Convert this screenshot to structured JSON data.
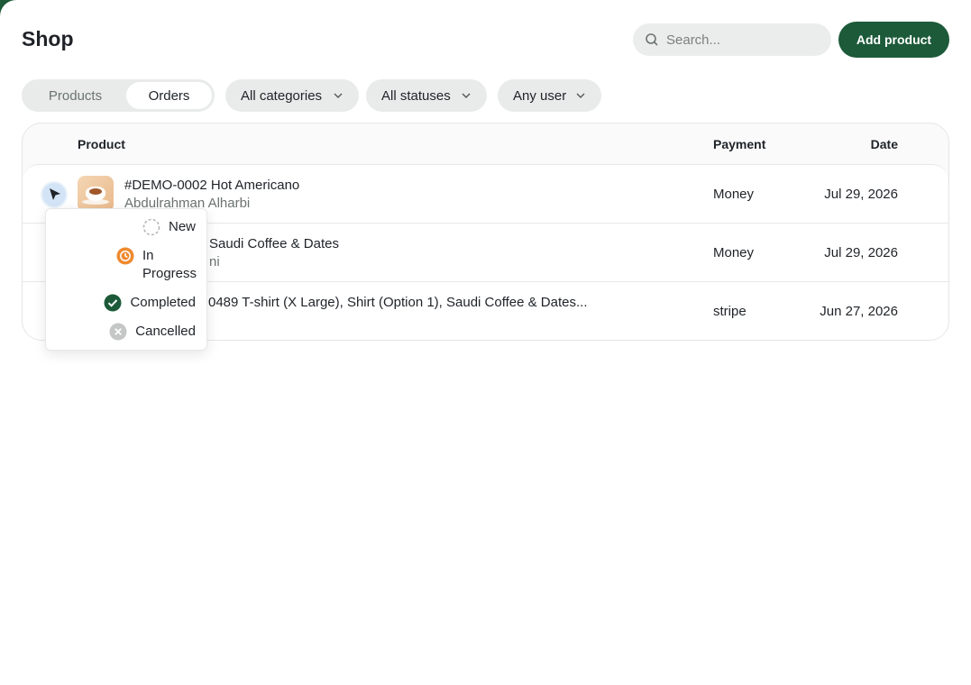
{
  "header": {
    "title": "Shop",
    "search_placeholder": "Search...",
    "add_button": "Add product"
  },
  "tabs": [
    {
      "label": "Products",
      "active": false
    },
    {
      "label": "Orders",
      "active": true
    }
  ],
  "filters": [
    {
      "label": "All categories"
    },
    {
      "label": "All statuses"
    },
    {
      "label": "Any user"
    }
  ],
  "table": {
    "columns": {
      "product": "Product",
      "payment": "Payment",
      "date": "Date"
    },
    "rows": [
      {
        "title": "#DEMO-0002 Hot Americano",
        "subtitle": "Abdulrahman Alharbi",
        "payment": "Money",
        "date": "Jul 29, 2026"
      },
      {
        "title": "Saudi Coffee & Dates",
        "subtitle": "ni",
        "payment": "Money",
        "date": "Jul 29, 2026"
      },
      {
        "title": "0489 T-shirt (X Large), Shirt (Option 1), Saudi Coffee & Dates...",
        "subtitle": "",
        "payment": "stripe",
        "date": "Jun 27, 2026"
      }
    ]
  },
  "status_menu": {
    "options": [
      {
        "label": "New",
        "icon": "dashed-circle-icon",
        "color": "#b5b8b7"
      },
      {
        "label": "In Progress",
        "icon": "clock-icon",
        "color": "#ef8a2f"
      },
      {
        "label": "Completed",
        "icon": "check-circle-icon",
        "color": "#1c5a39"
      },
      {
        "label": "Cancelled",
        "icon": "x-circle-icon",
        "color": "#c4c7c6"
      }
    ]
  },
  "colors": {
    "brand": "#1c5a39",
    "accent_status": "#d3e4f6"
  }
}
